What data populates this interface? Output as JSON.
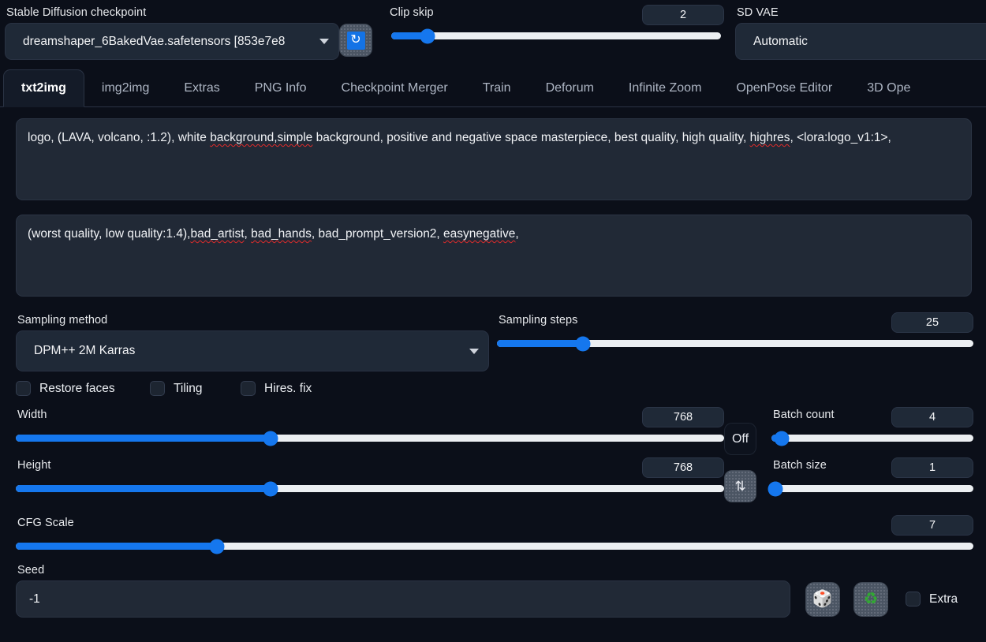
{
  "topbar": {
    "checkpoint": {
      "label": "Stable Diffusion checkpoint",
      "value": "dreamshaper_6BakedVae.safetensors [853e7e8 ",
      "caret_icon": "chevron-down-icon"
    },
    "refresh": {
      "icon": "refresh-icon",
      "glyph": "↻"
    },
    "clip_skip": {
      "label": "Clip skip",
      "value": "2",
      "fill_percent": 11
    },
    "sd_vae": {
      "label": "SD VAE",
      "value": "Automatic"
    }
  },
  "tabs": [
    {
      "label": "txt2img",
      "active": true
    },
    {
      "label": "img2img",
      "active": false
    },
    {
      "label": "Extras",
      "active": false
    },
    {
      "label": "PNG Info",
      "active": false
    },
    {
      "label": "Checkpoint Merger",
      "active": false
    },
    {
      "label": "Train",
      "active": false
    },
    {
      "label": "Deforum",
      "active": false
    },
    {
      "label": "Infinite Zoom",
      "active": false
    },
    {
      "label": "OpenPose Editor",
      "active": false
    },
    {
      "label": "3D Ope",
      "active": false
    }
  ],
  "prompts": {
    "positive": {
      "segments": [
        {
          "text": "logo, (LAVA, volcano, :1.2), white ",
          "spell_error": false
        },
        {
          "text": "background,simple",
          "spell_error": true
        },
        {
          "text": " background, positive and negative space masterpiece, best quality, high quality, ",
          "spell_error": false
        },
        {
          "text": "highres",
          "spell_error": true
        },
        {
          "text": ", <lora:logo_v1:1>,",
          "spell_error": false
        }
      ]
    },
    "negative": {
      "segments": [
        {
          "text": "(worst quality, low quality:1.4),",
          "spell_error": false
        },
        {
          "text": "bad_artist",
          "spell_error": true
        },
        {
          "text": ", ",
          "spell_error": false
        },
        {
          "text": "bad_hands",
          "spell_error": true
        },
        {
          "text": ", bad_prompt_version2, ",
          "spell_error": false
        },
        {
          "text": "easynegative",
          "spell_error": true
        },
        {
          "text": ",",
          "spell_error": false
        }
      ]
    }
  },
  "sampling": {
    "method_label": "Sampling method",
    "method_value": "DPM++ 2M Karras",
    "steps_label": "Sampling steps",
    "steps_value": "25",
    "steps_fill_percent": 18
  },
  "checkboxes": [
    {
      "label": "Restore faces",
      "checked": false
    },
    {
      "label": "Tiling",
      "checked": false
    },
    {
      "label": "Hires. fix",
      "checked": false
    }
  ],
  "dimensions": {
    "width": {
      "label": "Width",
      "value": "768",
      "fill_percent": 36
    },
    "height": {
      "label": "Height",
      "value": "768",
      "fill_percent": 36
    },
    "aspect_button": "Off",
    "swap_button_icon": "swap-vertical-icon",
    "swap_glyph": "⇅"
  },
  "batch": {
    "count": {
      "label": "Batch count",
      "value": "4",
      "fill_percent": 5
    },
    "size": {
      "label": "Batch size",
      "value": "1",
      "fill_percent": 2
    }
  },
  "cfg": {
    "label": "CFG Scale",
    "value": "7",
    "fill_percent": 21
  },
  "seed": {
    "label": "Seed",
    "value": "-1",
    "dice_icon": "dice-icon",
    "dice_glyph": "🎲",
    "recycle_icon": "recycle-icon",
    "recycle_glyph": "♻",
    "extra_label": "Extra",
    "extra_checked": false
  },
  "colors": {
    "background": "#0b0f19",
    "panel": "#212936",
    "accent_blue": "#1577ee",
    "track": "#eceff2",
    "spell_error": "#e02b2b",
    "recycle_green": "#31a832"
  }
}
